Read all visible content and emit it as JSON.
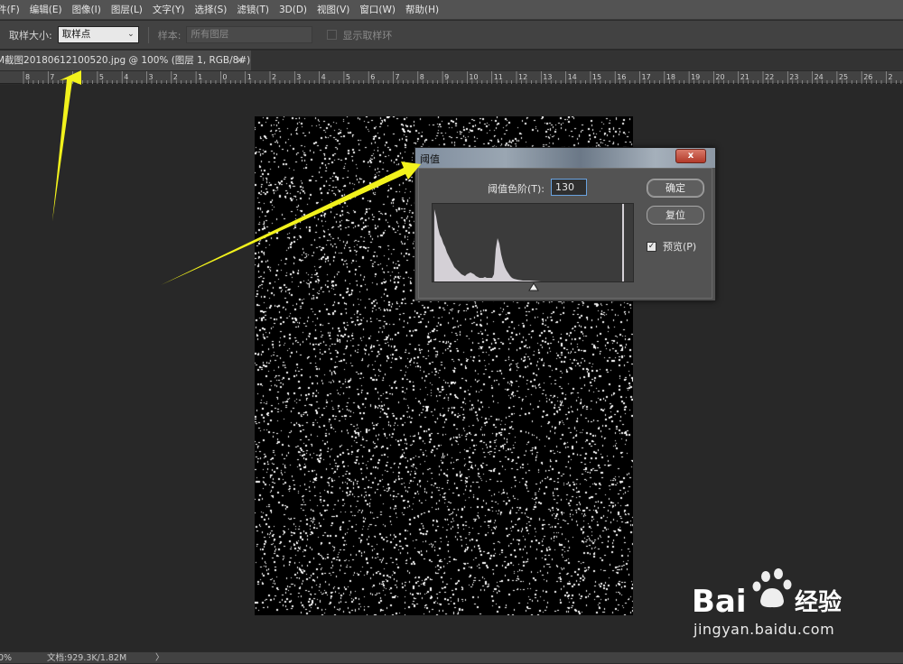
{
  "menubar": {
    "items": [
      "件(F)",
      "编辑(E)",
      "图像(I)",
      "图层(L)",
      "文字(Y)",
      "选择(S)",
      "滤镜(T)",
      "3D(D)",
      "视图(V)",
      "窗口(W)",
      "帮助(H)"
    ]
  },
  "options": {
    "sample_size_label": "取样大小:",
    "sample_size_value": "取样点",
    "sample_label": "样本:",
    "sample_value": "所有图层",
    "show_ring_label": "显示取样环"
  },
  "document": {
    "tab_title": "M截图20180612100520.jpg @ 100% (图层 1, RGB/8#) *",
    "tab_close": "×"
  },
  "ruler": {
    "labels": [
      "8",
      "7",
      "6",
      "5",
      "4",
      "3",
      "2",
      "1",
      "0",
      "1",
      "2",
      "3",
      "4",
      "5",
      "6",
      "7",
      "8",
      "9",
      "10",
      "11",
      "12",
      "13",
      "14",
      "15",
      "16",
      "17",
      "18",
      "19",
      "20",
      "21",
      "22",
      "23",
      "24",
      "25",
      "26",
      "2"
    ]
  },
  "dialog": {
    "title": "阈值",
    "close": "x",
    "threshold_label": "阈值色阶(T):",
    "threshold_value": "130",
    "ok_label": "确定",
    "reset_label": "复位",
    "preview_label": "预览(P)",
    "preview_checked": true
  },
  "status": {
    "zoom": "0%",
    "doc_size": "文档:929.3K/1.82M",
    "more": "〉"
  },
  "watermark": {
    "brand": "Bai",
    "brand2": "经验",
    "url": "jingyan.baidu.com"
  },
  "colors": {
    "annotation_arrow": "#f2f21c",
    "menubar": "#535353",
    "workspace": "#282828"
  }
}
